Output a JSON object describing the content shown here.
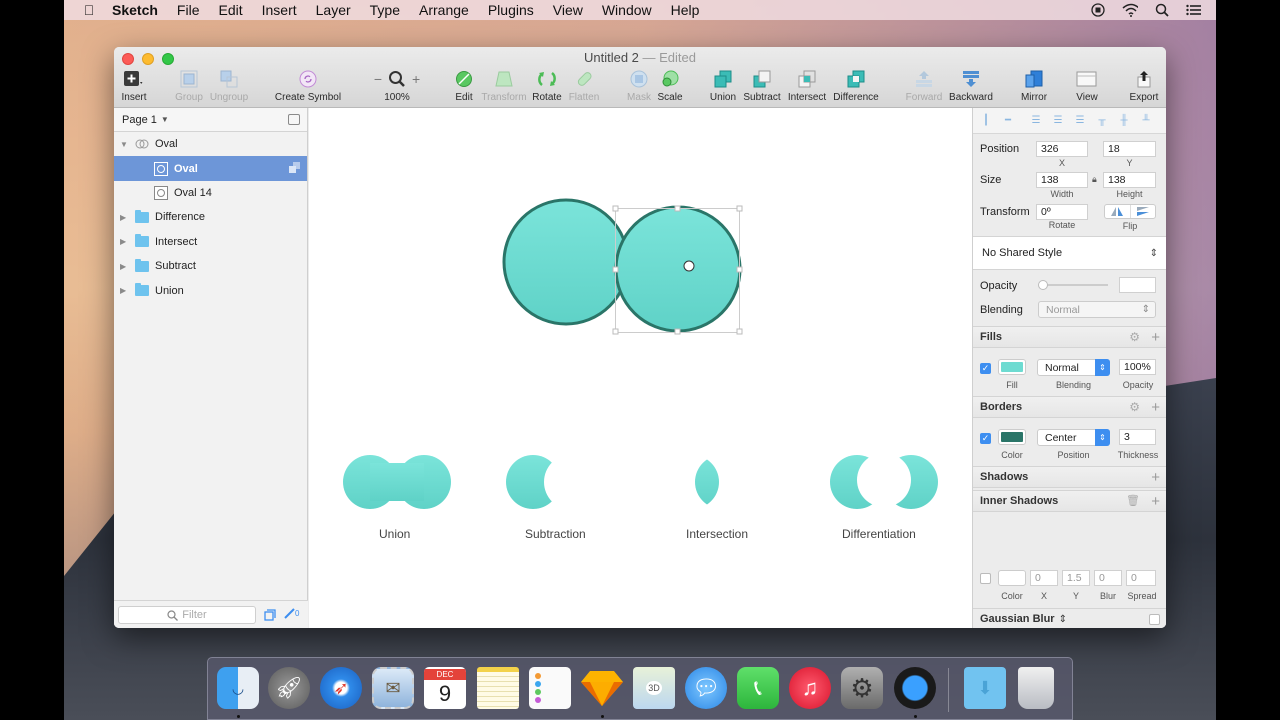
{
  "menubar": {
    "app": "Sketch",
    "items": [
      "File",
      "Edit",
      "Insert",
      "Layer",
      "Type",
      "Arrange",
      "Plugins",
      "View",
      "Window",
      "Help"
    ],
    "status_icons": [
      "record-icon",
      "wifi-icon",
      "spotlight-search-icon",
      "notification-center-icon"
    ]
  },
  "window": {
    "title": "Untitled 2",
    "title_sep": "—",
    "title_state": "Edited"
  },
  "toolbar": {
    "insert": "Insert",
    "group": "Group",
    "ungroup": "Ungroup",
    "create_symbol": "Create Symbol",
    "zoom_minus": "−",
    "zoom_plus": "+",
    "zoom": "100%",
    "edit": "Edit",
    "transform": "Transform",
    "rotate": "Rotate",
    "flatten": "Flatten",
    "mask": "Mask",
    "scale": "Scale",
    "union": "Union",
    "subtract": "Subtract",
    "intersect": "Intersect",
    "difference": "Difference",
    "forward": "Forward",
    "backward": "Backward",
    "mirror": "Mirror",
    "view": "View",
    "export": "Export"
  },
  "sidebar": {
    "page": "Page 1",
    "layers": [
      {
        "name": "Oval",
        "type": "boolean-group",
        "expanded": true,
        "depth": 0
      },
      {
        "name": "Oval",
        "type": "oval",
        "selected": true,
        "depth": 1
      },
      {
        "name": "Oval 14",
        "type": "oval",
        "depth": 1
      },
      {
        "name": "Difference",
        "type": "folder",
        "depth": 0
      },
      {
        "name": "Intersect",
        "type": "folder",
        "depth": 0
      },
      {
        "name": "Subtract",
        "type": "folder",
        "depth": 0
      },
      {
        "name": "Union",
        "type": "folder",
        "depth": 0
      }
    ],
    "filter_placeholder": "Filter",
    "edit_count": "0"
  },
  "canvas": {
    "fill_color": "#6ddbd1",
    "border_color": "#2a7568",
    "examples": [
      {
        "label": "Union"
      },
      {
        "label": "Subtraction"
      },
      {
        "label": "Intersection"
      },
      {
        "label": "Differentiation"
      }
    ]
  },
  "inspector": {
    "position_label": "Position",
    "x": "326",
    "y": "18",
    "x_label": "X",
    "y_label": "Y",
    "size_label": "Size",
    "width": "138",
    "height": "138",
    "width_label": "Width",
    "height_label": "Height",
    "transform_label": "Transform",
    "rotate": "0º",
    "rotate_label": "Rotate",
    "flip_label": "Flip",
    "shared_style": "No Shared Style",
    "opacity_label": "Opacity",
    "opacity_value": "",
    "blending_label": "Blending",
    "blending_value": "Normal",
    "fills": {
      "title": "Fills",
      "enabled": true,
      "color": "#6ddbd1",
      "blending": "Normal",
      "opacity": "100%",
      "fill_label": "Fill",
      "blending_label": "Blending",
      "opacity_label": "Opacity"
    },
    "borders": {
      "title": "Borders",
      "enabled": true,
      "color": "#2a7568",
      "position": "Center",
      "thickness": "3",
      "color_label": "Color",
      "position_label": "Position",
      "thickness_label": "Thickness"
    },
    "shadows_title": "Shadows",
    "inner_shadows": {
      "title": "Inner Shadows",
      "enabled": false,
      "x": "0",
      "y": "1.5",
      "blur": "0",
      "spread": "0",
      "color_label": "Color",
      "x_label": "X",
      "y_label": "Y",
      "blur_label": "Blur",
      "spread_label": "Spread"
    },
    "gaussian_blur": "Gaussian Blur"
  },
  "dock": {
    "calendar_month": "DEC",
    "calendar_day": "9",
    "apps": [
      "Finder",
      "Launchpad",
      "Safari",
      "Mail",
      "Calendar",
      "Notes",
      "Reminders",
      "Sketch",
      "Maps",
      "Messages",
      "FaceTime",
      "iTunes",
      "System Preferences",
      "QuickTime Player",
      "Downloads",
      "Trash"
    ]
  }
}
